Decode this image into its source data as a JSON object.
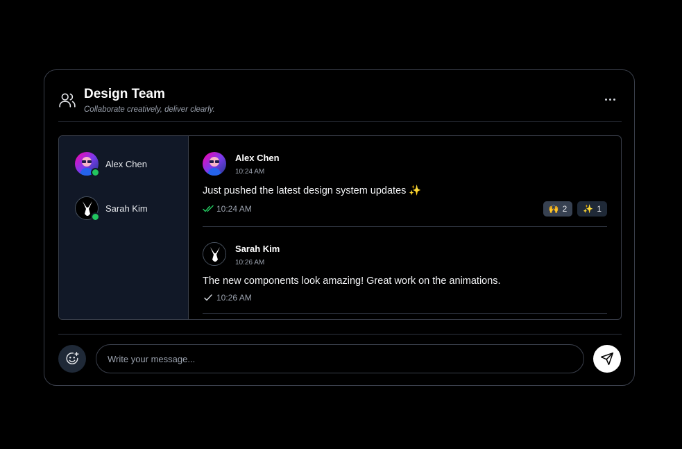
{
  "header": {
    "title": "Design Team",
    "subtitle": "Collaborate creatively, deliver clearly."
  },
  "members": [
    {
      "name": "Alex Chen",
      "status": "online"
    },
    {
      "name": "Sarah Kim",
      "status": "online"
    }
  ],
  "messages": [
    {
      "author": "Alex Chen",
      "time": "10:24 AM",
      "text": "Just pushed the latest design system updates ✨",
      "status_time": "10:24 AM",
      "read": true,
      "reactions": [
        {
          "emoji": "🙌",
          "count": "2"
        },
        {
          "emoji": "✨",
          "count": "1"
        }
      ]
    },
    {
      "author": "Sarah Kim",
      "time": "10:26 AM",
      "text": "The new components look amazing! Great work on the animations.",
      "status_time": "10:26 AM",
      "read": false,
      "reactions": []
    }
  ],
  "composer": {
    "placeholder": "Write your message..."
  },
  "colors": {
    "online": "#22c55e",
    "read_check": "#22c55e",
    "sidebar_bg": "#111827"
  },
  "icons": [
    "users-icon",
    "more-icon",
    "emoji-add-icon",
    "send-icon",
    "double-check-icon",
    "check-icon"
  ]
}
